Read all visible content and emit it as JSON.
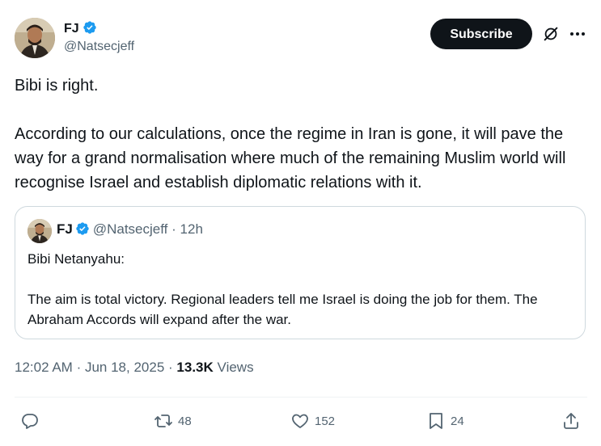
{
  "colors": {
    "text": "#0f1419",
    "secondary": "#536471",
    "verified": "#1d9bf0",
    "border": "#cfd9de",
    "subscribe_bg": "#0f1419"
  },
  "author": {
    "name": "FJ",
    "handle": "@Natsecjeff",
    "avatar_icon": "profile-photo"
  },
  "header": {
    "subscribe_label": "Subscribe",
    "grok_icon": "slashed-circle-icon",
    "more_icon": "ellipsis-icon"
  },
  "tweet": {
    "text": "Bibi is right.\n\nAccording to our calculations, once the regime in Iran is gone, it will pave the way for a grand normalisation where much of the remaining Muslim world will recognise Israel and establish diplomatic relations with it."
  },
  "quote": {
    "name": "FJ",
    "handle": "@Natsecjeff",
    "separator": "·",
    "time": "12h",
    "text": "Bibi Netanyahu:\n\nThe aim is total victory. Regional leaders tell me Israel is doing the job for them. The Abraham Accords will expand after the war."
  },
  "meta": {
    "time": "12:02 AM",
    "sep1": "·",
    "date": "Jun 18, 2025",
    "sep2": "·",
    "views_count": "13.3K",
    "views_label": "Views"
  },
  "actions": {
    "reply_count": "",
    "retweet_count": "48",
    "like_count": "152",
    "bookmark_count": "24"
  }
}
